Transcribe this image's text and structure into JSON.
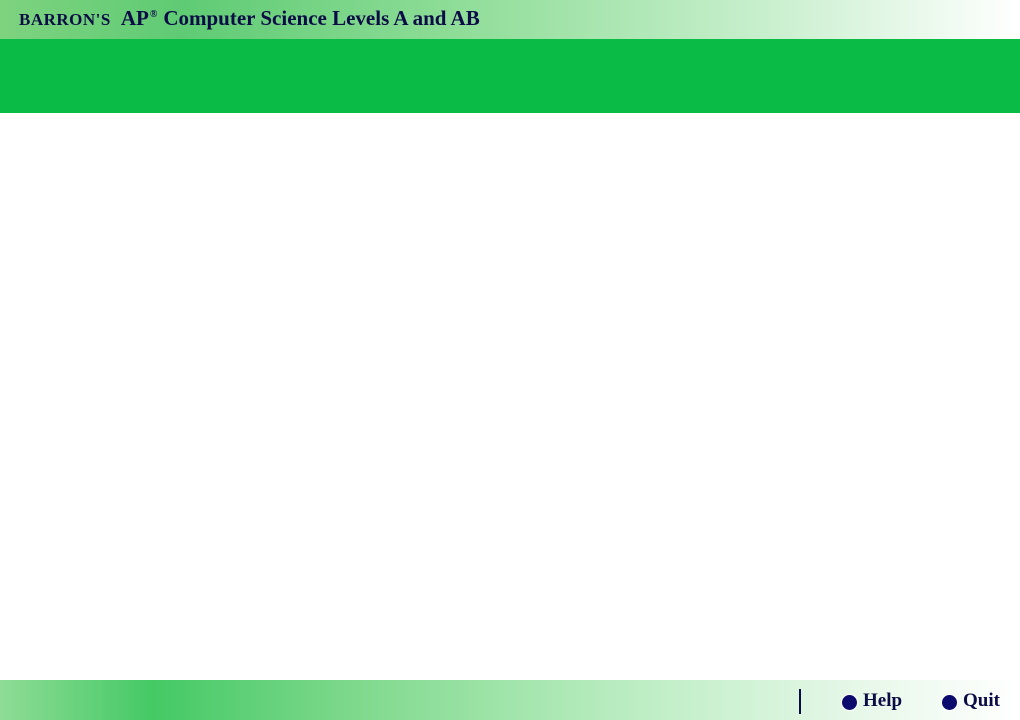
{
  "header": {
    "brand": "BARRON'S",
    "ap": "AP",
    "registered": "®",
    "product": "Computer Science Levels A and AB"
  },
  "footer": {
    "help_label": "Help",
    "quit_label": "Quit"
  },
  "colors": {
    "band_green": "#0abb45",
    "text_navy": "#0b0b45",
    "button_dot": "#0b0b6e"
  }
}
